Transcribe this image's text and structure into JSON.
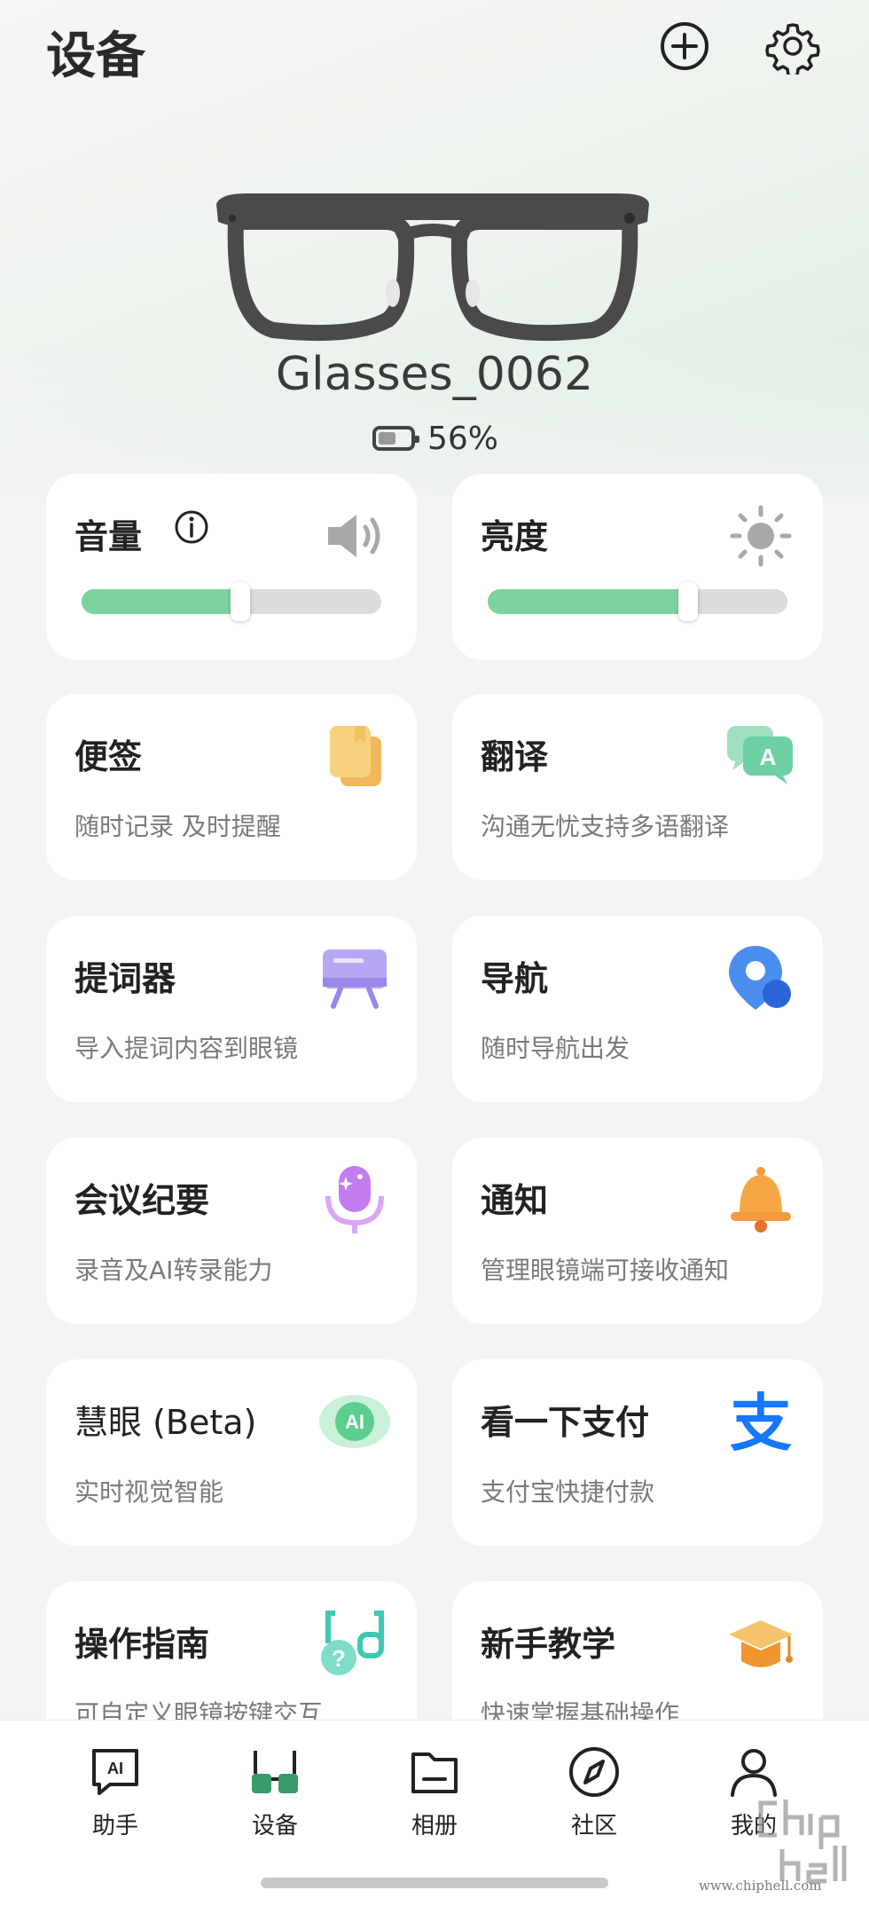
{
  "header": {
    "title": "设备"
  },
  "device": {
    "name": "Glasses_0062",
    "battery_text": "56%",
    "battery_level": 0.56
  },
  "controls": {
    "volume": {
      "label": "音量",
      "level": 0.53
    },
    "brightness": {
      "label": "亮度",
      "level": 0.67
    }
  },
  "cards": [
    {
      "title": "便签",
      "subtitle": "随时记录 及时提醒",
      "icon": "notes-icon"
    },
    {
      "title": "翻译",
      "subtitle": "沟通无忧支持多语翻译",
      "icon": "translate-icon"
    },
    {
      "title": "提词器",
      "subtitle": "导入提词内容到眼镜",
      "icon": "teleprompter-icon"
    },
    {
      "title": "导航",
      "subtitle": "随时导航出发",
      "icon": "navigation-icon"
    },
    {
      "title": "会议纪要",
      "subtitle": "录音及AI转录能力",
      "icon": "microphone-icon"
    },
    {
      "title": "通知",
      "subtitle": "管理眼镜端可接收通知",
      "icon": "bell-icon"
    },
    {
      "title": "慧眼 (Beta)",
      "subtitle": "实时视觉智能",
      "icon": "ai-vision-icon",
      "icon_text": "AI"
    },
    {
      "title": "看一下支付",
      "subtitle": "支付宝快捷付款",
      "icon": "alipay-icon",
      "icon_text": "支"
    },
    {
      "title": "操作指南",
      "subtitle": "可自定义眼镜按键交互",
      "icon": "guide-icon"
    },
    {
      "title": "新手教学",
      "subtitle": "快速掌握基础操作",
      "icon": "graduation-cap-icon"
    }
  ],
  "nav": [
    {
      "label": "助手",
      "icon": "ai-assistant-icon",
      "icon_text": "AI"
    },
    {
      "label": "设备",
      "icon": "glasses-icon",
      "active": true
    },
    {
      "label": "相册",
      "icon": "album-folder-icon"
    },
    {
      "label": "社区",
      "icon": "compass-icon"
    },
    {
      "label": "我的",
      "icon": "profile-icon"
    }
  ],
  "colors": {
    "accent": "#7dd3a0",
    "nav_active": "#3a9a6a"
  },
  "watermark": {
    "text": "chip hell",
    "url_text": "www.chiphell.com"
  }
}
